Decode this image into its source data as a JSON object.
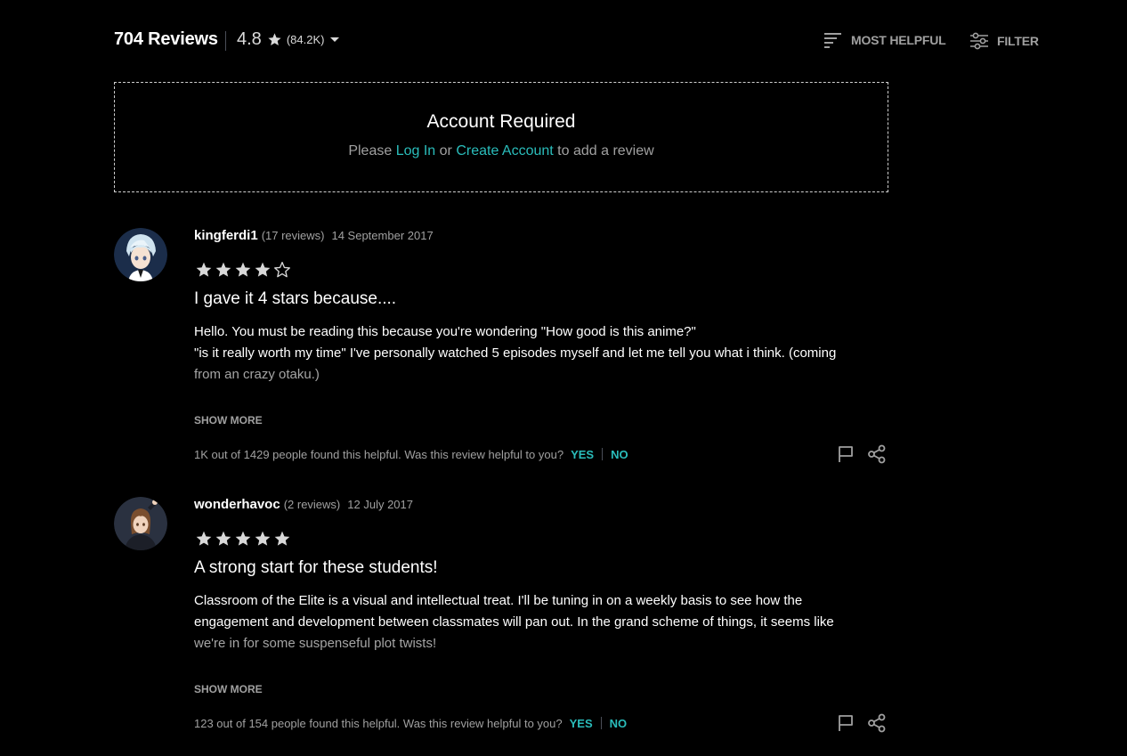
{
  "header": {
    "reviews_count": "704 Reviews",
    "rating_value": "4.8",
    "rating_count": "(84.2K)",
    "sort_label": "MOST HELPFUL",
    "filter_label": "FILTER"
  },
  "account_box": {
    "title": "Account Required",
    "text_before": "Please ",
    "login_link": "Log In",
    "text_middle": " or ",
    "create_link": "Create Account",
    "text_after": " to add a review"
  },
  "reviews": [
    {
      "author": "kingferdi1",
      "author_reviews": "(17 reviews)",
      "date": "14 September 2017",
      "rating": 4,
      "title": "I gave it 4 stars because....",
      "body_lines": [
        "Hello. You must be reading this because you're wondering \"How good is this anime?\"",
        "\"is it really worth my time\" I've personally watched 5 episodes myself and let me tell you what i think. (coming",
        "from an crazy otaku.)"
      ],
      "show_more": "SHOW MORE",
      "helpful_text": "1K out of 1429 people found this helpful. Was this review helpful to you?",
      "yes_label": "YES",
      "no_label": "NO"
    },
    {
      "author": "wonderhavoc",
      "author_reviews": "(2 reviews)",
      "date": "12 July 2017",
      "rating": 5,
      "title": "A strong start for these students!",
      "body_lines": [
        "Classroom of the Elite is a visual and intellectual treat. I'll be tuning in on a weekly basis to see how the",
        "engagement and development between classmates will pan out. In the grand scheme of things, it seems like",
        "we're in for some suspenseful plot twists!"
      ],
      "show_more": "SHOW MORE",
      "helpful_text": "123 out of 154 people found this helpful. Was this review helpful to you?",
      "yes_label": "YES",
      "no_label": "NO"
    }
  ],
  "colors": {
    "background": "#000000",
    "accent": "#2abdbb",
    "muted_text": "#a0a0a0",
    "divider": "#4a4e58"
  },
  "icons": {
    "sort": "sort-lines-icon",
    "filter": "sliders-icon",
    "flag": "flag-icon",
    "share": "share-icon",
    "star": "star-icon",
    "caret": "caret-down-icon"
  }
}
